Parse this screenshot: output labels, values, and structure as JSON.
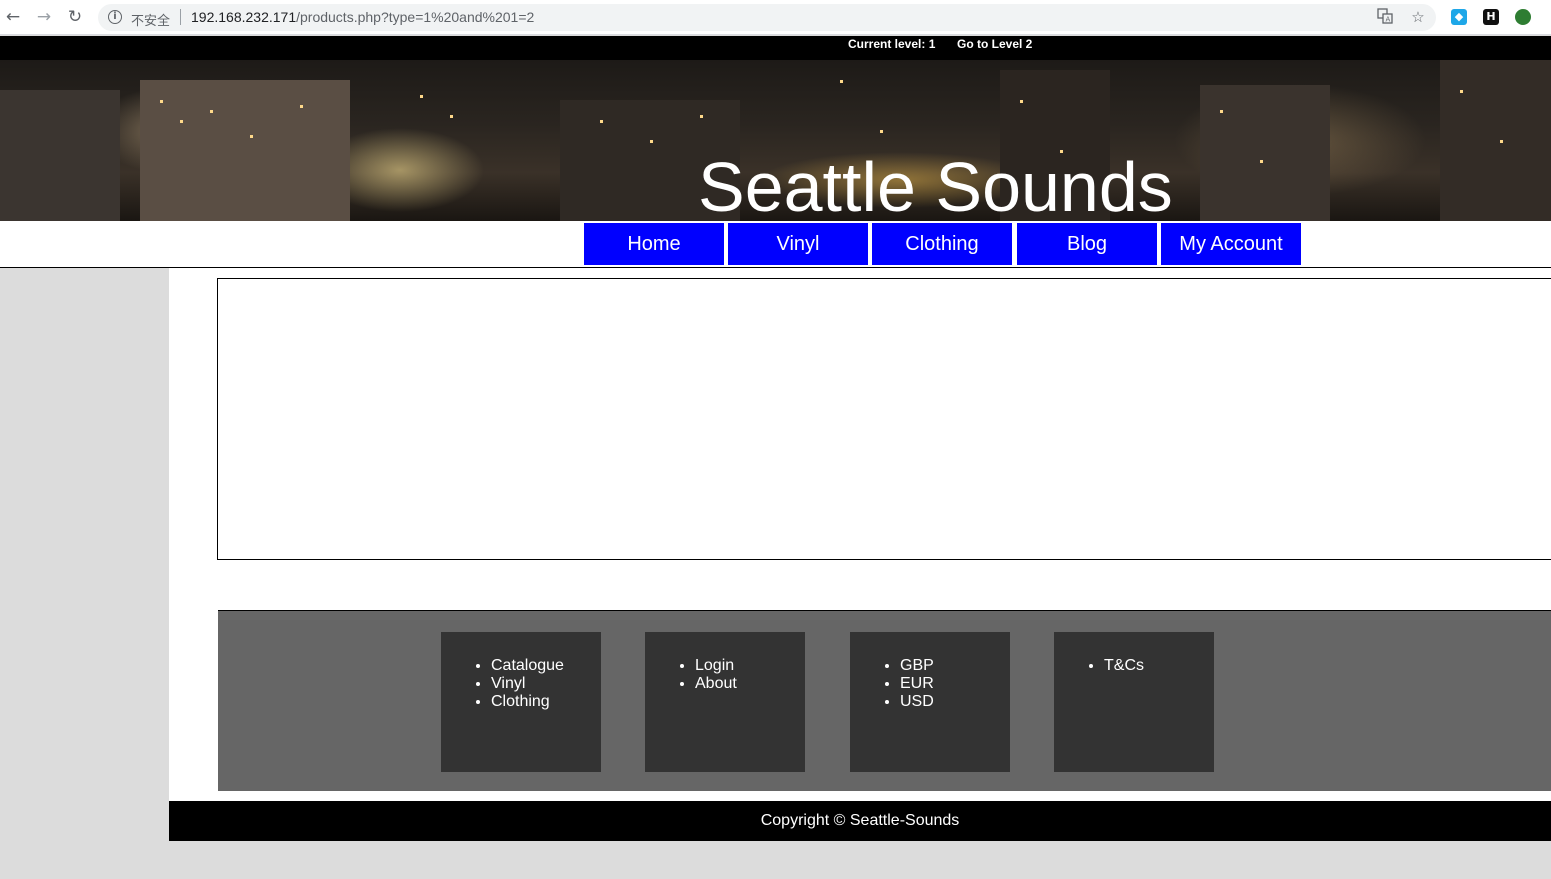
{
  "browser": {
    "back": "←",
    "forward": "→",
    "reload": "↻",
    "info": "i",
    "insecure_label": "不安全",
    "url_host": "192.168.232.171",
    "url_path": "/products.php?type=1%20and%201=2",
    "translate_icon": "translate-icon",
    "star_icon": "☆"
  },
  "levelbar": {
    "current": "Current level: 1",
    "go": "Go to Level 2"
  },
  "site": {
    "title": "Seattle Sounds"
  },
  "nav": [
    {
      "label": "Home"
    },
    {
      "label": "Vinyl"
    },
    {
      "label": "Clothing"
    },
    {
      "label": "Blog"
    },
    {
      "label": "My Account"
    }
  ],
  "footer": {
    "columns": [
      {
        "items": [
          "Catalogue",
          "Vinyl",
          "Clothing"
        ]
      },
      {
        "items": [
          "Login",
          "About"
        ]
      },
      {
        "items": [
          "GBP",
          "EUR",
          "USD"
        ]
      },
      {
        "items": [
          "T&Cs"
        ]
      }
    ],
    "copyright": "Copyright © Seattle-Sounds"
  },
  "colors": {
    "nav_bg": "#0000ff",
    "footer_bg": "#666666",
    "footer_col_bg": "#333333"
  }
}
